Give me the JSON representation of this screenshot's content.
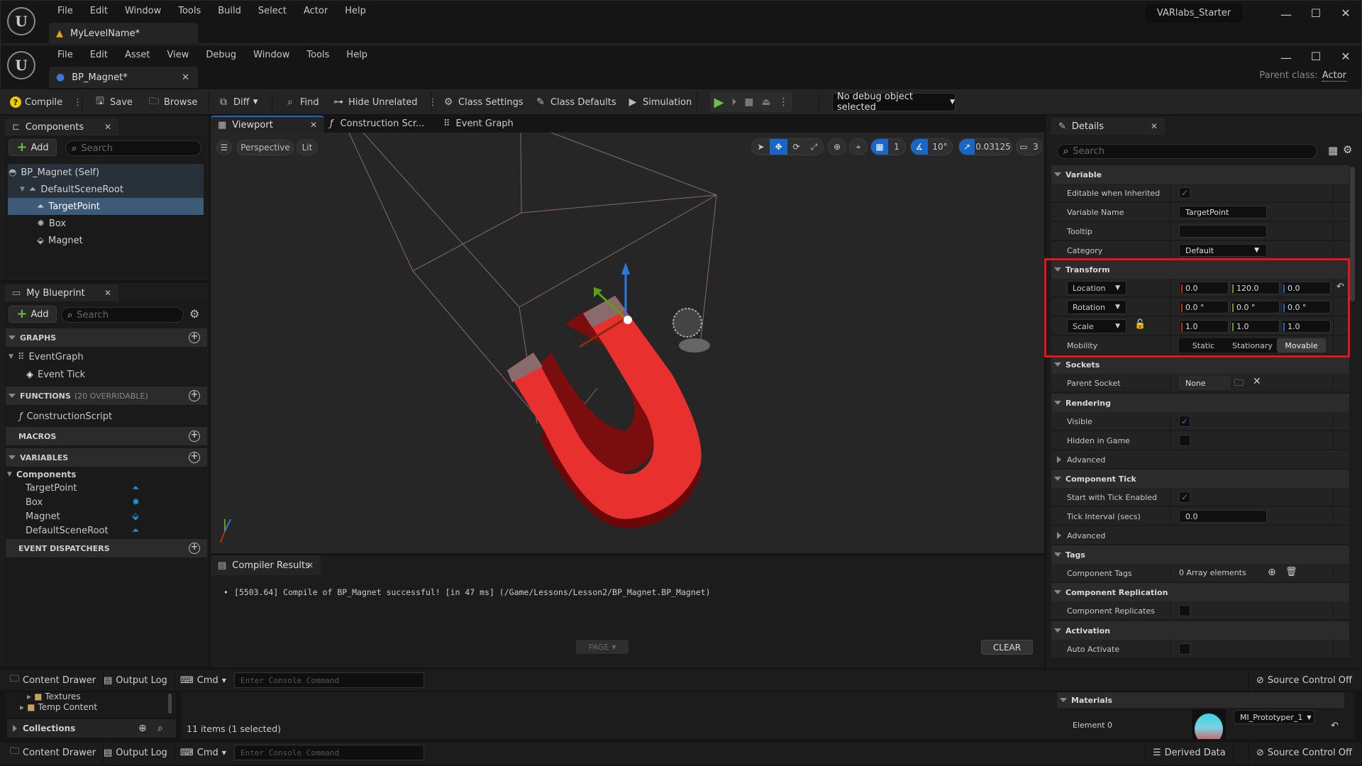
{
  "outer_window": {
    "menu": [
      "File",
      "Edit",
      "Window",
      "Tools",
      "Build",
      "Select",
      "Actor",
      "Help"
    ],
    "level_tab": "MyLevelName*",
    "project_name": "VARlabs_Starter",
    "controls": {
      "minimize": "—",
      "maximize": "☐",
      "close": "✕"
    }
  },
  "blueprint_window": {
    "menu": [
      "File",
      "Edit",
      "Asset",
      "View",
      "Debug",
      "Window",
      "Tools",
      "Help"
    ],
    "doc_tab": "BP_Magnet*",
    "parent_class_label": "Parent class:",
    "parent_class_value": "Actor",
    "controls": {
      "minimize": "—",
      "maximize": "☐",
      "close": "✕"
    }
  },
  "toolbar": {
    "compile": "Compile",
    "save": "Save",
    "browse": "Browse",
    "diff": "Diff",
    "find": "Find",
    "hide_unrelated": "Hide Unrelated",
    "class_settings": "Class Settings",
    "class_defaults": "Class Defaults",
    "simulation": "Simulation",
    "debug_object": "No debug object selected",
    "play_color": "#6cc04a"
  },
  "components_panel": {
    "title": "Components",
    "add": "Add",
    "search_placeholder": "Search",
    "tree": [
      {
        "label": "BP_Magnet (Self)",
        "icon": "actor-icon",
        "level": 0,
        "selected": false
      },
      {
        "label": "DefaultSceneRoot",
        "icon": "scene-component-icon",
        "level": 1,
        "selected": false
      },
      {
        "label": "TargetPoint",
        "icon": "scene-component-icon",
        "level": 2,
        "selected": true
      },
      {
        "label": "Box",
        "icon": "box-collision-icon",
        "level": 2,
        "selected": false
      },
      {
        "label": "Magnet",
        "icon": "static-mesh-icon",
        "level": 2,
        "selected": false
      }
    ]
  },
  "my_blueprint": {
    "title": "My Blueprint",
    "add": "Add",
    "search_placeholder": "Search",
    "sections": {
      "graphs": "GRAPHS",
      "functions": "FUNCTIONS",
      "functions_note": "(20 OVERRIDABLE)",
      "macros": "MACROS",
      "variables": "VARIABLES",
      "event_dispatchers": "EVENT DISPATCHERS"
    },
    "event_graph": "EventGraph",
    "event_tick": "Event Tick",
    "construction_script": "ConstructionScript",
    "components_category": "Components",
    "variables": [
      "TargetPoint",
      "Box",
      "Magnet",
      "DefaultSceneRoot"
    ]
  },
  "editor_tabs": [
    "Viewport",
    "Construction Scr...",
    "Event Graph"
  ],
  "viewport": {
    "view_mode": "Perspective",
    "lighting": "Lit",
    "grid_snap": "1",
    "rotation_snap": "10°",
    "scale_snap": "0.03125",
    "camera_speed": "3",
    "magnet_color": "#e8302e"
  },
  "compiler_results": {
    "title": "Compiler Results",
    "message": "[5503.64] Compile of BP_Magnet successful! [in 47 ms] (/Game/Lessons/Lesson2/BP_Magnet.BP_Magnet)",
    "page_button": "PAGE",
    "clear_button": "CLEAR"
  },
  "details": {
    "title": "Details",
    "search_placeholder": "Search",
    "variable": {
      "header": "Variable",
      "editable_label": "Editable when Inherited",
      "editable": true,
      "name_label": "Variable Name",
      "name_value": "TargetPoint",
      "tooltip_label": "Tooltip",
      "tooltip_value": "",
      "category_label": "Category",
      "category_value": "Default"
    },
    "transform": {
      "header": "Transform",
      "location_label": "Location",
      "location": [
        "0.0",
        "120.0",
        "0.0"
      ],
      "rotation_label": "Rotation",
      "rotation": [
        "0.0 °",
        "0.0 °",
        "0.0 °"
      ],
      "scale_label": "Scale",
      "scale": [
        "1.0",
        "1.0",
        "1.0"
      ],
      "mobility_label": "Mobility",
      "mobility_options": [
        "Static",
        "Stationary",
        "Movable"
      ],
      "mobility_selected": "Movable"
    },
    "sockets": {
      "header": "Sockets",
      "parent_socket_label": "Parent Socket",
      "parent_socket_value": "None"
    },
    "rendering": {
      "header": "Rendering",
      "visible_label": "Visible",
      "visible": true,
      "hidden_label": "Hidden in Game",
      "hidden": false,
      "advanced": "Advanced"
    },
    "component_tick": {
      "header": "Component Tick",
      "start_label": "Start with Tick Enabled",
      "start": true,
      "interval_label": "Tick Interval (secs)",
      "interval_value": "0.0",
      "advanced": "Advanced"
    },
    "tags": {
      "header": "Tags",
      "component_tags_label": "Component Tags",
      "component_tags_value": "0 Array elements"
    },
    "replication": {
      "header": "Component Replication",
      "replicates_label": "Component Replicates",
      "replicates": false
    },
    "activation": {
      "header": "Activation",
      "auto_activate_label": "Auto Activate",
      "auto_activate": false
    }
  },
  "statusbar_1": {
    "content_drawer": "Content Drawer",
    "output_log": "Output Log",
    "cmd": "Cmd",
    "console_placeholder": "Enter Console Command",
    "source_control": "Source Control Off"
  },
  "content_browser": {
    "folders": [
      "Textures",
      "Temp Content"
    ],
    "collections": "Collections",
    "item_count": "11 items (1 selected)",
    "materials_header": "Materials",
    "element_label": "Element 0",
    "material_value": "MI_Prototyper_1"
  },
  "statusbar_2": {
    "content_drawer": "Content Drawer",
    "output_log": "Output Log",
    "cmd": "Cmd",
    "console_placeholder": "Enter Console Command",
    "derived_data": "Derived Data",
    "source_control": "Source Control Off"
  }
}
